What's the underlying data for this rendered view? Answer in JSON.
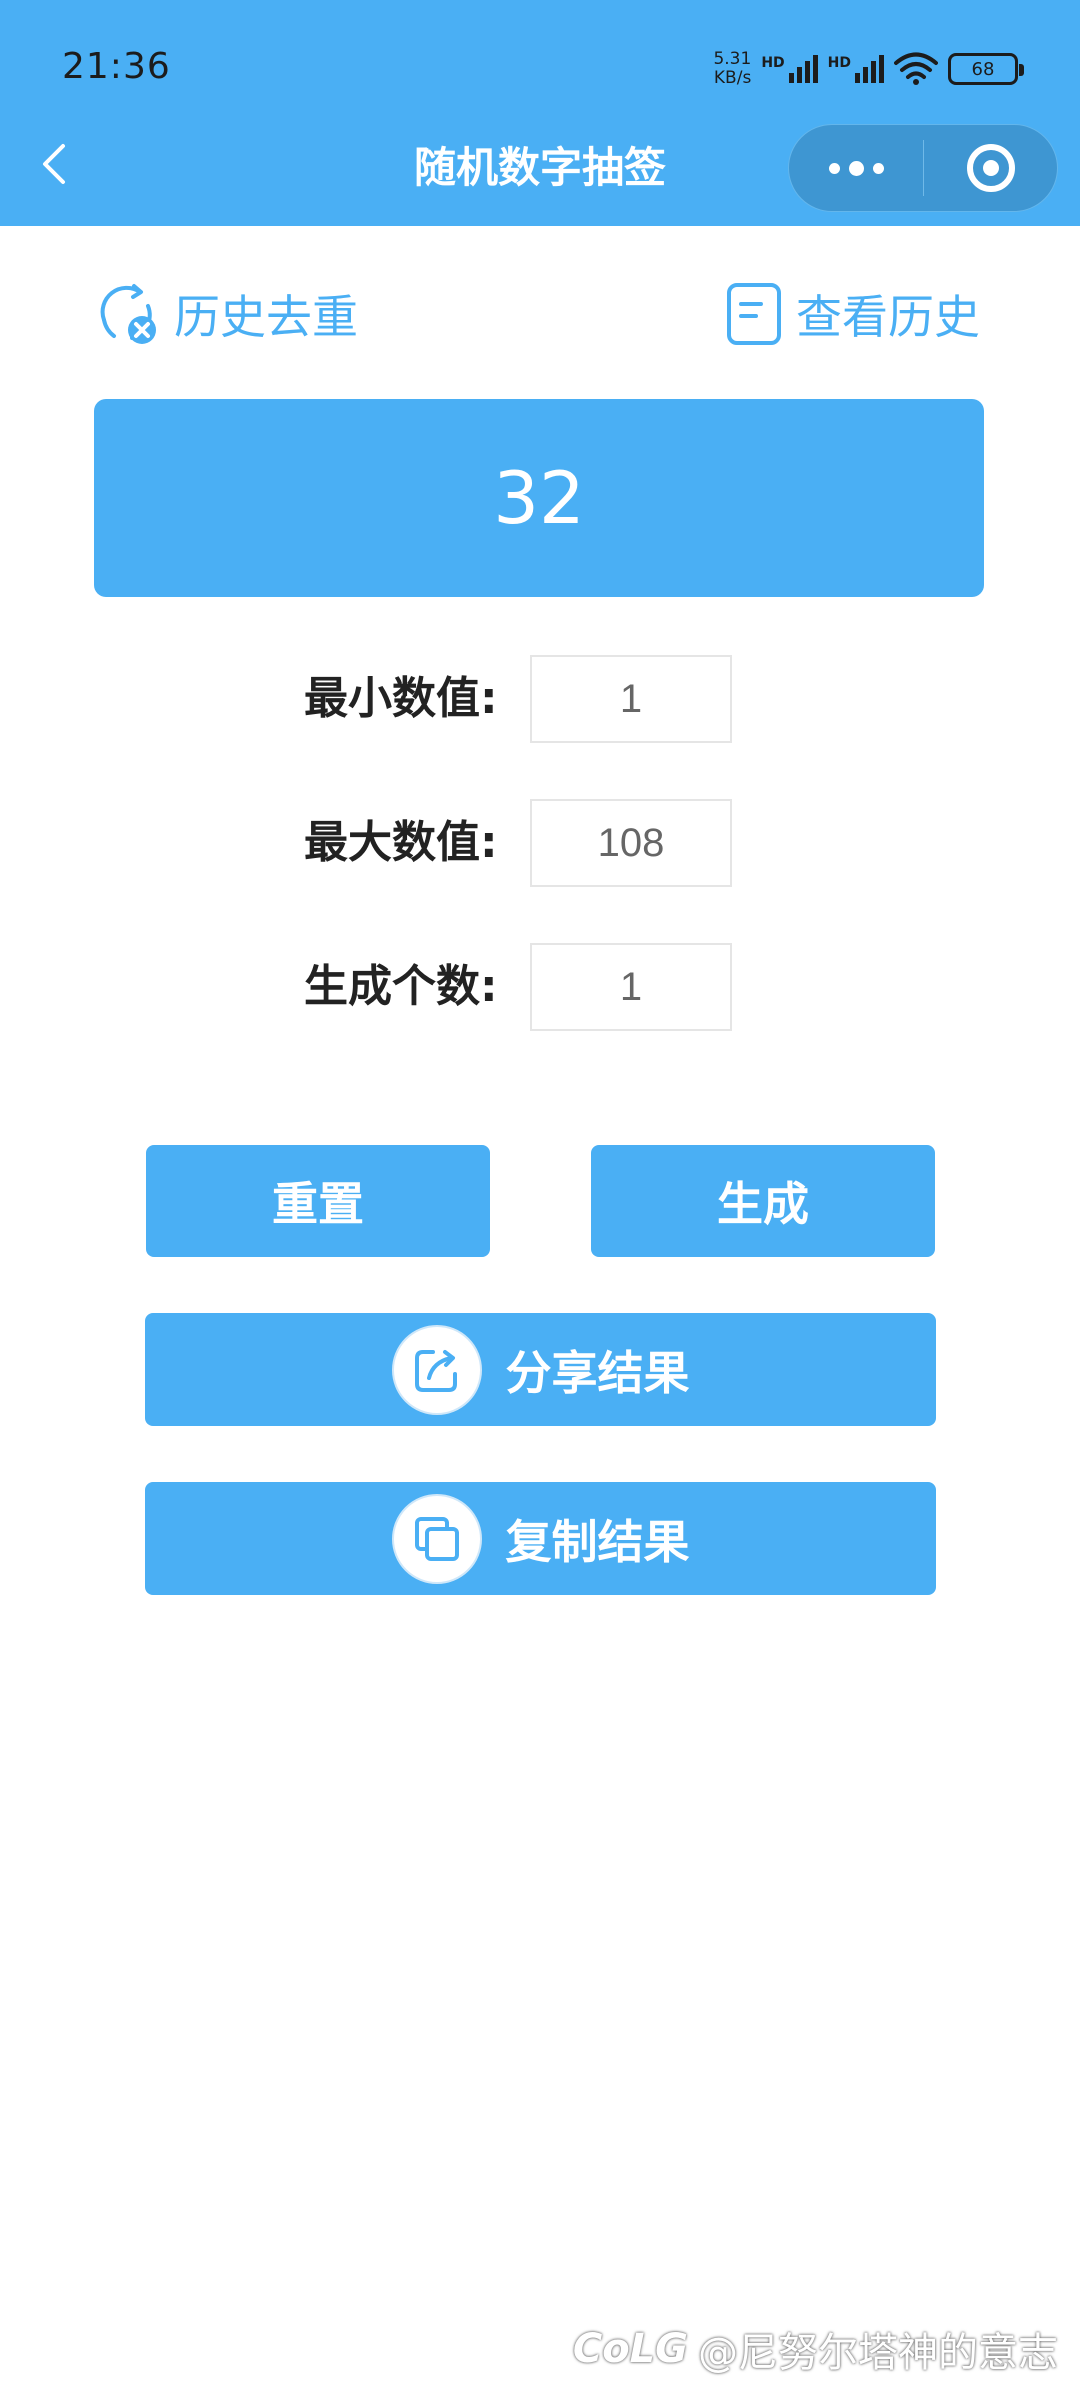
{
  "status_bar": {
    "time": "21:36",
    "net_speed_value": "5.31",
    "net_speed_unit": "KB/s",
    "signal_1_label": "HD",
    "signal_2_label": "HD",
    "battery": "68"
  },
  "nav": {
    "title": "随机数字抽签"
  },
  "actions": {
    "history_dedup_label": "历史去重",
    "view_history_label": "查看历史"
  },
  "result": {
    "value": "32"
  },
  "form": {
    "min_label": "最小数值:",
    "min_value": "1",
    "max_label": "最大数值:",
    "max_value": "108",
    "count_label": "生成个数:",
    "count_value": "1"
  },
  "buttons": {
    "reset_label": "重置",
    "generate_label": "生成",
    "share_label": "分享结果",
    "copy_label": "复制结果"
  },
  "watermark": {
    "logo": "CoLG",
    "text": "@尼努尔塔神的意志"
  },
  "colors": {
    "accent": "#4aaff4",
    "capsule": "#3e96d2",
    "text_dark": "#222222",
    "field_text": "#666666"
  },
  "icons": {
    "back": "chevron-left-icon",
    "more": "more-dots-icon",
    "close": "circle-target-icon",
    "dedup": "refresh-x-icon",
    "history": "document-icon",
    "share": "share-icon",
    "copy": "copy-icon"
  }
}
